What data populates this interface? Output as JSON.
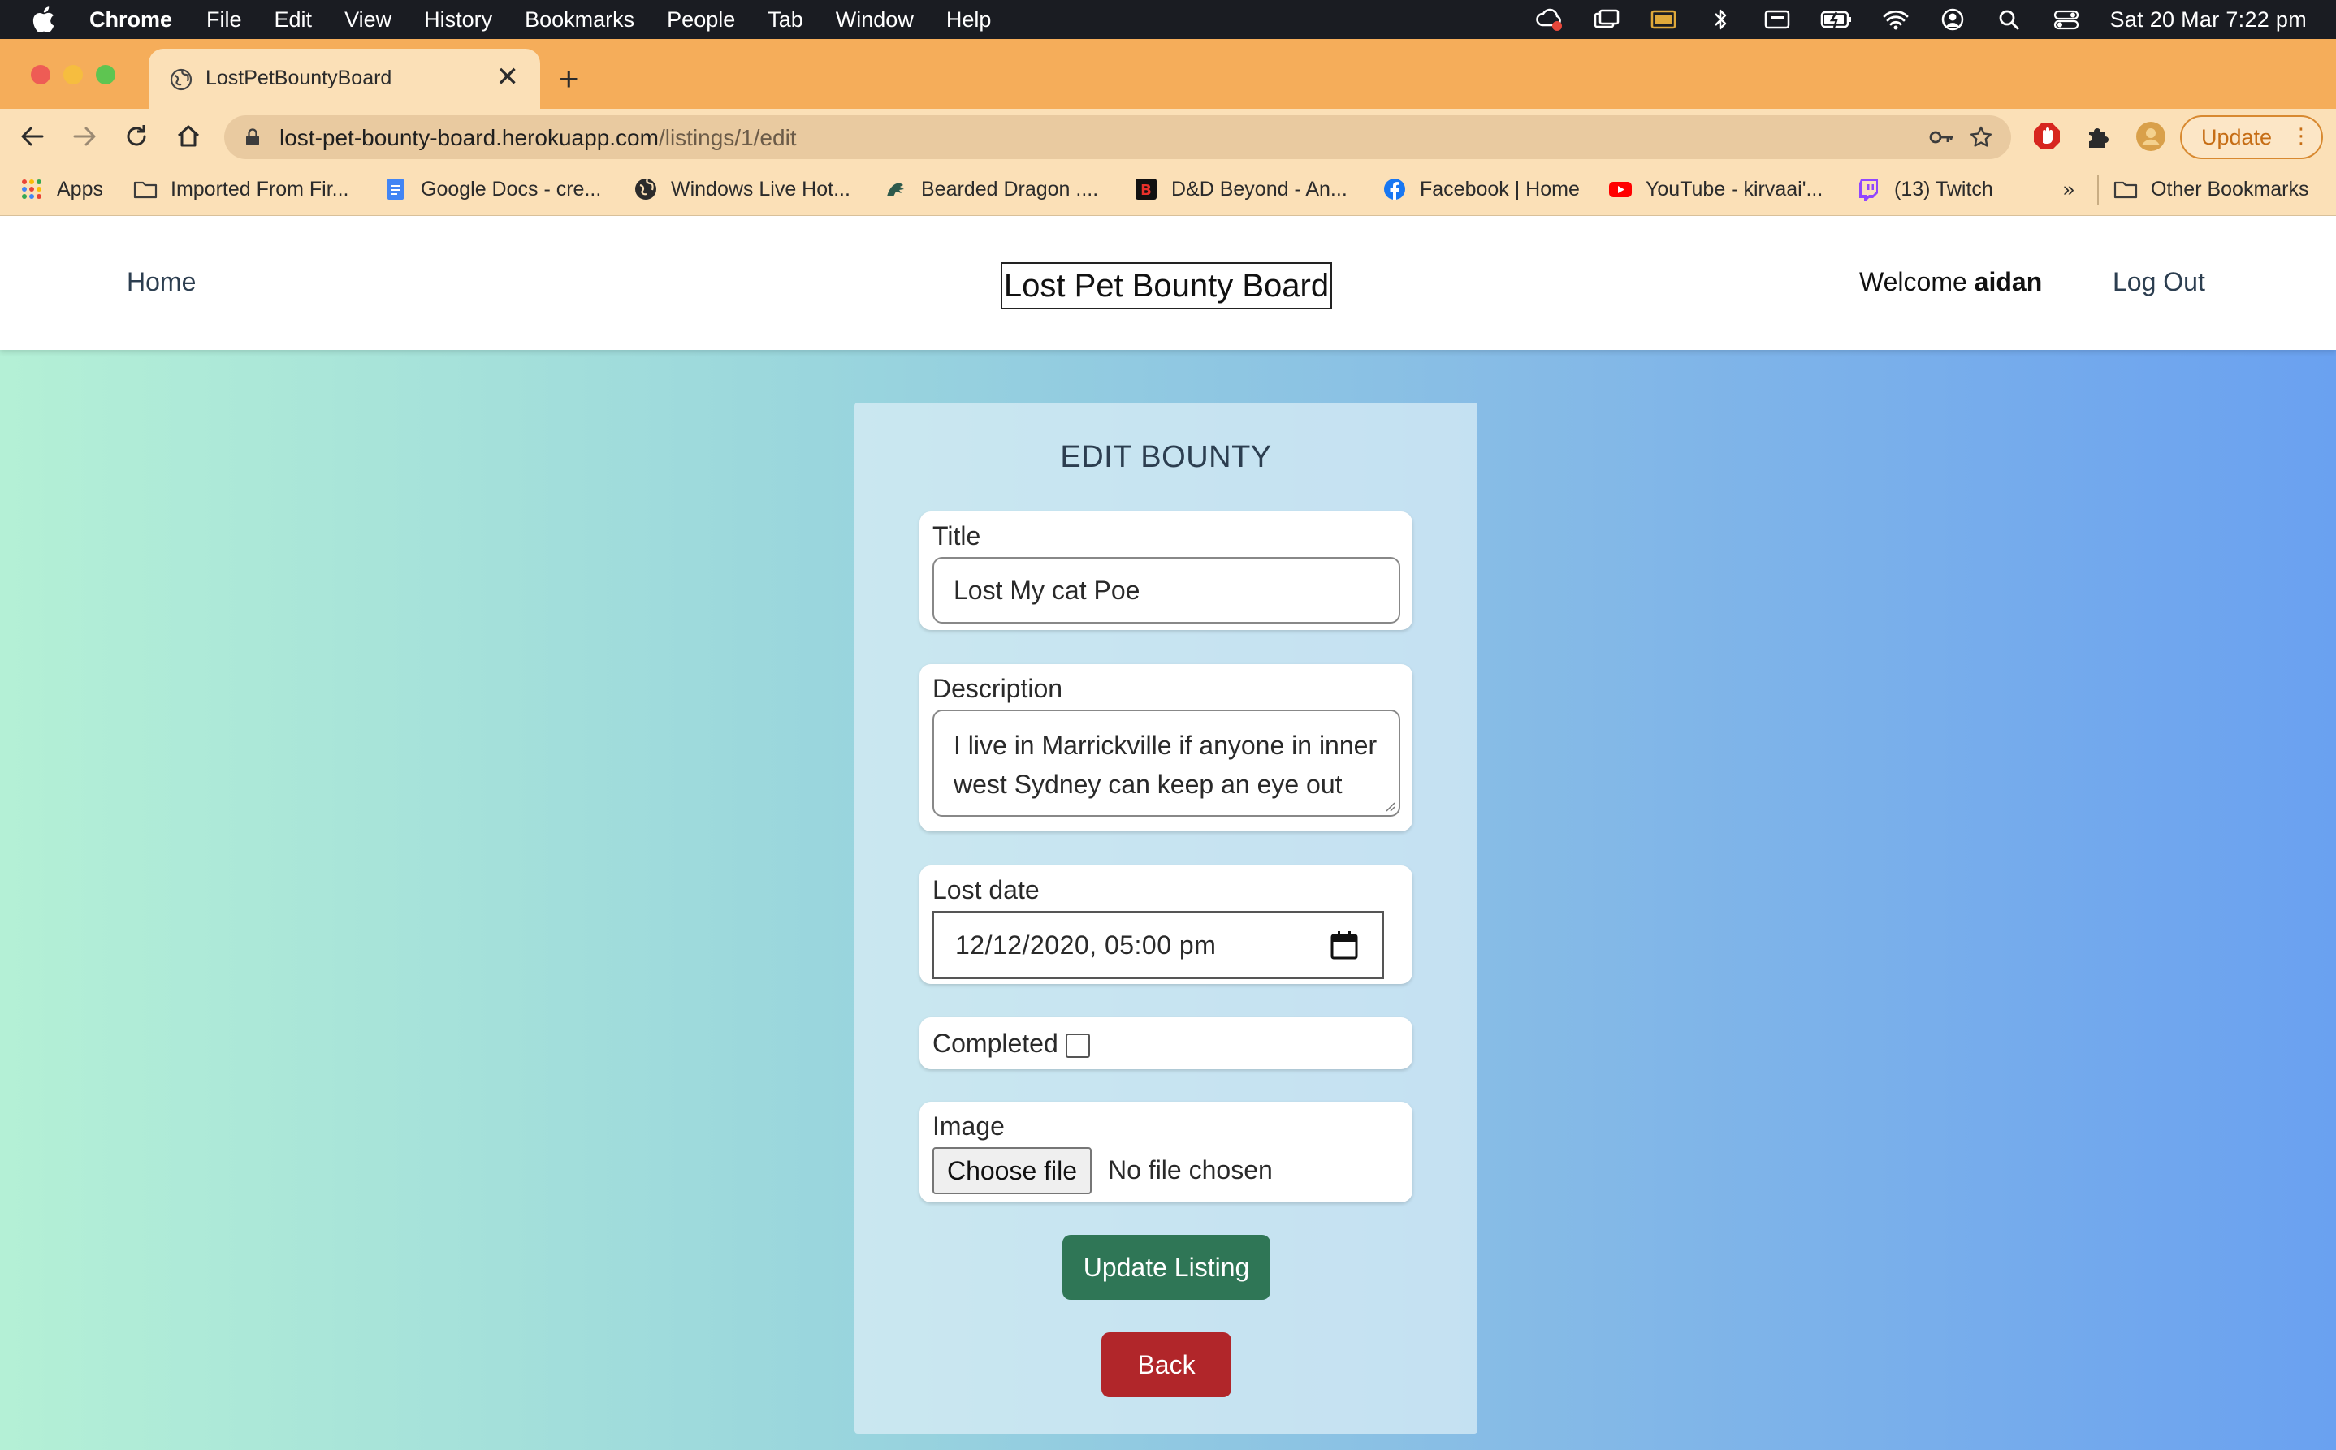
{
  "menubar": {
    "app_name": "Chrome",
    "menus": [
      "File",
      "Edit",
      "View",
      "History",
      "Bookmarks",
      "People",
      "Tab",
      "Window",
      "Help"
    ],
    "clock": "Sat 20 Mar  7:22 pm"
  },
  "browser": {
    "tab_title": "LostPetBountyBoard",
    "tab_close": "✕",
    "new_tab": "+",
    "url_host": "lost-pet-bounty-board.herokuapp.com",
    "url_path": "/listings/1/edit",
    "update_label": "Update",
    "bookmarks": [
      {
        "label": "Apps",
        "icon": "apps-grid-icon"
      },
      {
        "label": "Imported From Fir...",
        "icon": "folder-icon"
      },
      {
        "label": "Google Docs - cre...",
        "icon": "google-docs-icon"
      },
      {
        "label": "Windows Live Hot...",
        "icon": "globe-icon"
      },
      {
        "label": "Bearded Dragon ....",
        "icon": "dragon-icon"
      },
      {
        "label": "D&D Beyond - An...",
        "icon": "dndbeyond-icon"
      },
      {
        "label": "Facebook | Home",
        "icon": "facebook-icon"
      },
      {
        "label": "YouTube - kirvaai'...",
        "icon": "youtube-icon"
      },
      {
        "label": "(13) Twitch",
        "icon": "twitch-icon"
      }
    ],
    "bookmarks_overflow": "»",
    "other_bookmarks": "Other Bookmarks"
  },
  "navbar": {
    "home": "Home",
    "brand": "Lost Pet Bounty Board",
    "welcome_prefix": "Welcome ",
    "username": "aidan",
    "logout": "Log Out"
  },
  "form": {
    "heading": "EDIT BOUNTY",
    "title_label": "Title",
    "title_value": "Lost My cat Poe",
    "description_label": "Description",
    "description_value": "I live in Marrickville if anyone in inner west Sydney can keep an eye out",
    "lost_date_label": "Lost date",
    "lost_date_value": "12/12/2020, 05:00 pm",
    "completed_label": "Completed",
    "completed_checked": false,
    "image_label": "Image",
    "file_button": "Choose file",
    "file_status": "No file chosen",
    "submit_label": "Update Listing",
    "back_label": "Back"
  },
  "colors": {
    "tabstrip": "#f5ad5a",
    "toolbar": "#fbe0b7",
    "update_button": "#2f7656",
    "back_button": "#b1262a",
    "gradient_left": "#b4f0d6",
    "gradient_right": "#6aa1f0"
  }
}
